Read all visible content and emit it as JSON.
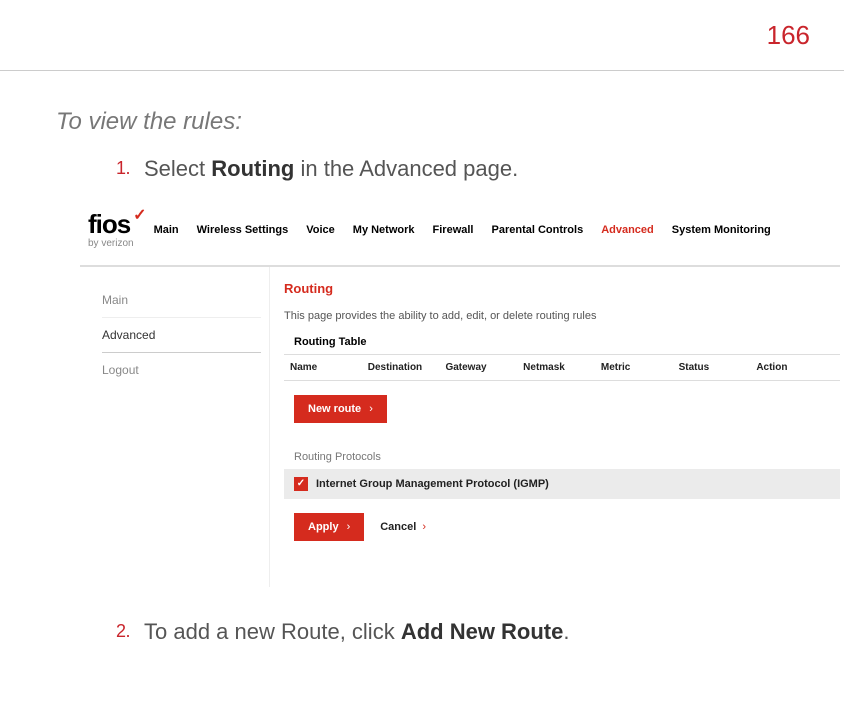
{
  "page_number": "166",
  "intro": "To view the rules:",
  "steps": [
    {
      "num": "1.",
      "pre": "Select ",
      "bold": "Routing",
      "post": " in the Advanced page."
    },
    {
      "num": "2.",
      "pre": "To add a new Route, click ",
      "bold": "Add New Route",
      "post": "."
    }
  ],
  "logo": {
    "text": "fios",
    "sub": "by verizon"
  },
  "nav": [
    "Main",
    "Wireless Settings",
    "Voice",
    "My Network",
    "Firewall",
    "Parental Controls",
    "Advanced",
    "System Monitoring"
  ],
  "nav_active_index": 6,
  "sidebar": [
    "Main",
    "Advanced",
    "Logout"
  ],
  "sidebar_active_index": 1,
  "panel": {
    "title": "Routing",
    "desc": "This page provides the ability to add, edit, or delete routing rules",
    "table_title": "Routing Table",
    "columns": [
      "Name",
      "Destination",
      "Gateway",
      "Netmask",
      "Metric",
      "Status",
      "Action"
    ],
    "new_route_btn": "New route",
    "protocols_title": "Routing Protocols",
    "protocol_label": "Internet Group Management Protocol (IGMP)",
    "apply_btn": "Apply",
    "cancel_btn": "Cancel"
  }
}
